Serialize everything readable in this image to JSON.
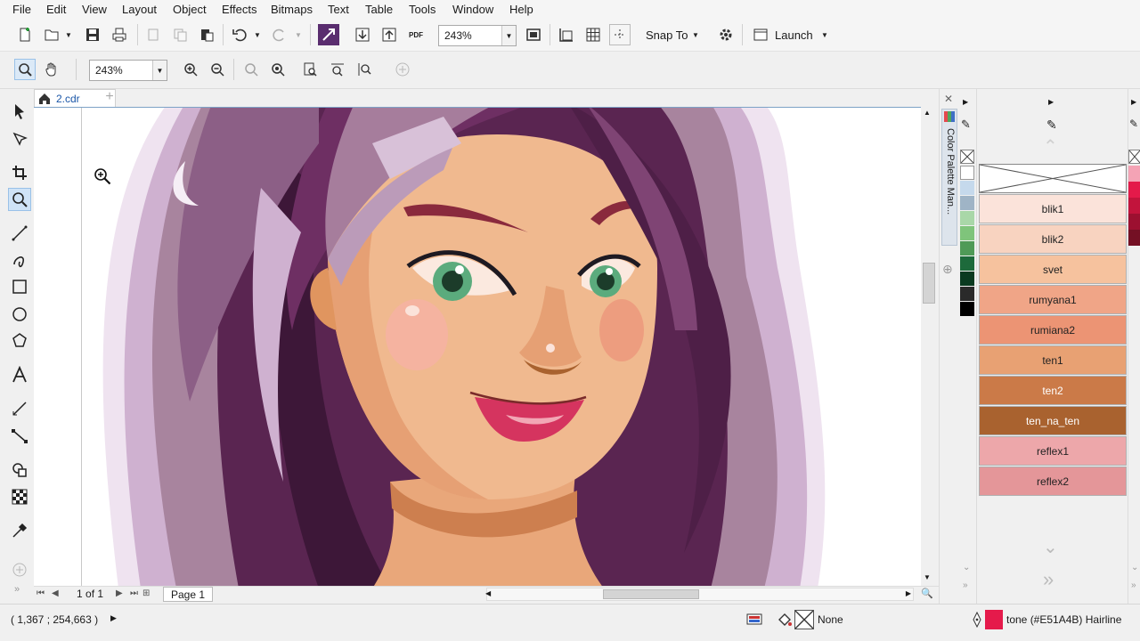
{
  "menu": [
    "File",
    "Edit",
    "View",
    "Layout",
    "Object",
    "Effects",
    "Bitmaps",
    "Text",
    "Table",
    "Tools",
    "Window",
    "Help"
  ],
  "menu_underline": [
    "F",
    "E",
    "V",
    "L",
    "O",
    "c",
    "B",
    "x",
    "T",
    "o",
    "W",
    "H"
  ],
  "toolbar": {
    "zoom_value": "243%",
    "snap_to": "Snap To",
    "launch": "Launch",
    "pdf_label": "PDF"
  },
  "zoombar": {
    "zoom_value": "243%"
  },
  "document": {
    "tab_name": "2.cdr"
  },
  "pager": {
    "current": "1",
    "of": "of",
    "total": "1",
    "page_tab": "Page 1"
  },
  "docker": {
    "title": "Color Palette Man..."
  },
  "palette": {
    "swatches": [
      {
        "name": "blik1",
        "color": "#FBE3DA",
        "text": "#222"
      },
      {
        "name": "blik2",
        "color": "#F8D3C0",
        "text": "#222"
      },
      {
        "name": "svet",
        "color": "#F6C29E",
        "text": "#222"
      },
      {
        "name": "rumyana1",
        "color": "#F0A587",
        "text": "#222"
      },
      {
        "name": "rumiana2",
        "color": "#EC9474",
        "text": "#222"
      },
      {
        "name": "ten1",
        "color": "#E8A173",
        "text": "#222"
      },
      {
        "name": "ten2",
        "color": "#CB7A48",
        "text": "#fff"
      },
      {
        "name": "ten_na_ten",
        "color": "#A9622F",
        "text": "#fff"
      },
      {
        "name": "reflex1",
        "color": "#EDA7AA",
        "text": "#222"
      },
      {
        "name": "reflex2",
        "color": "#E49699",
        "text": "#222"
      }
    ]
  },
  "mini_palette": [
    "#ffffff",
    "#c5d9ec",
    "#9fb4c6",
    "#a9d7a8",
    "#7fc47b",
    "#4f9a57",
    "#1d6a3b",
    "#0a3a20",
    "#2a2a2a",
    "#000000"
  ],
  "right_strip_colors": [
    "#f4a3b5",
    "#e41a4a",
    "#c2143c",
    "#9c1030",
    "#741024"
  ],
  "status": {
    "coords": "( 1,367 ; 254,663 )",
    "fill": "None",
    "outline": "tone (#E51A4B)  Hairline",
    "outline_color": "#E51A4B"
  }
}
